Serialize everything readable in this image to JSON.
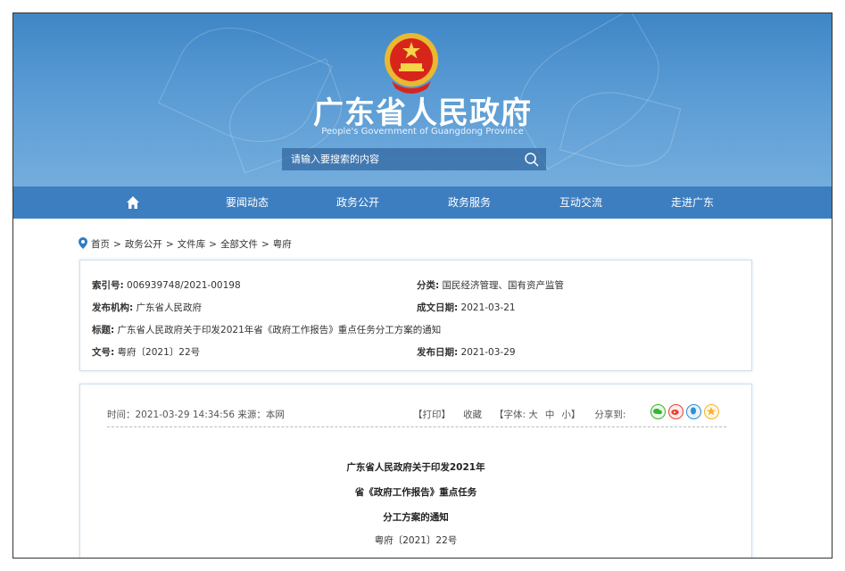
{
  "header": {
    "title": "广东省人民政府",
    "subtitle": "People's Government of Guangdong Province",
    "search_placeholder": "请输入要搜索的内容"
  },
  "nav": {
    "items": [
      "要闻动态",
      "政务公开",
      "政务服务",
      "互动交流",
      "走进广东"
    ]
  },
  "breadcrumb": [
    "首页",
    "政务公开",
    "文件库",
    "全部文件",
    "粤府"
  ],
  "meta": {
    "index_label": "索引号:",
    "index_value": "006939748/2021-00198",
    "category_label": "分类:",
    "category_value": "国民经济管理、国有资产监管",
    "publisher_label": "发布机构:",
    "publisher_value": "广东省人民政府",
    "created_label": "成文日期:",
    "created_value": "2021-03-21",
    "title_label": "标题:",
    "title_value": "广东省人民政府关于印发2021年省《政府工作报告》重点任务分工方案的通知",
    "docno_label": "文号:",
    "docno_value": "粤府〔2021〕22号",
    "pubdate_label": "发布日期:",
    "pubdate_value": "2021-03-29"
  },
  "article": {
    "info": "时间：2021-03-29 14:34:56   来源：本网",
    "print": "【打印】",
    "favorite": "收藏",
    "font_label": "【字体:",
    "font_large": "大",
    "font_medium": "中",
    "font_small": "小】",
    "share_label": "分享到:",
    "title_lines": [
      "广东省人民政府关于印发2021年",
      "省《政府工作报告》重点任务",
      "分工方案的通知"
    ],
    "doc_number": "粤府〔2021〕22号"
  },
  "colors": {
    "nav_bg": "#3d7ec0",
    "header_bg": "#5a9bd4",
    "share_wechat": "#3cb034",
    "share_weibo": "#e6412e",
    "share_qq": "#2d8fd5",
    "share_qzone": "#f5b428"
  }
}
